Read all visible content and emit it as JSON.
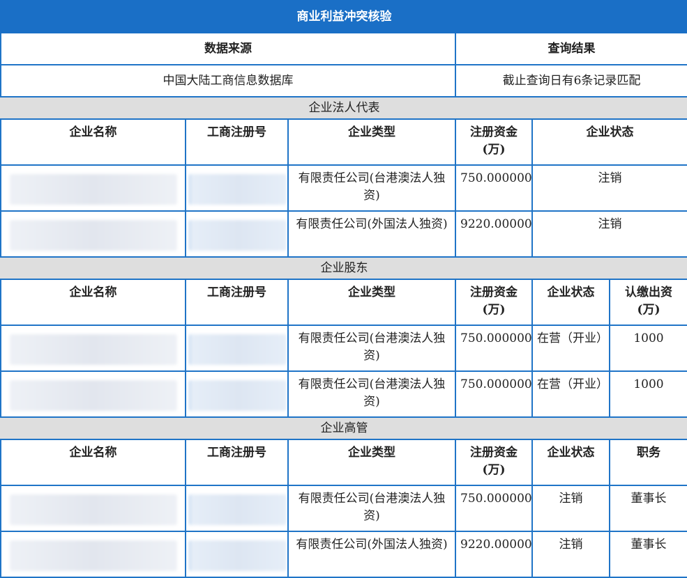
{
  "title": "商业利益冲突核验",
  "source": {
    "header_source": "数据来源",
    "header_result": "查询结果",
    "value_source": "中国大陆工商信息数据库",
    "value_result": "截止查询日有6条记录匹配"
  },
  "sections": {
    "legal": {
      "title": "企业法人代表",
      "headers": [
        "企业名称",
        "工商注册号",
        "企业类型",
        "注册资金(万)",
        "企业状态"
      ],
      "rows": [
        {
          "type": "有限责任公司(台港澳法人独资)",
          "capital": "750.000000",
          "status": "注销"
        },
        {
          "type": "有限责任公司(外国法人独资)",
          "capital": "9220.000000",
          "status": "注销"
        }
      ]
    },
    "shareholder": {
      "title": "企业股东",
      "headers": [
        "企业名称",
        "工商注册号",
        "企业类型",
        "注册资金(万)",
        "企业状态",
        "认缴出资(万)"
      ],
      "rows": [
        {
          "type": "有限责任公司(台港澳法人独资)",
          "capital": "750.000000",
          "status": "在营（开业）",
          "extra": "1000"
        },
        {
          "type": "有限责任公司(台港澳法人独资)",
          "capital": "750.000000",
          "status": "在营（开业）",
          "extra": "1000"
        }
      ]
    },
    "executive": {
      "title": "企业高管",
      "headers": [
        "企业名称",
        "工商注册号",
        "企业类型",
        "注册资金(万)",
        "企业状态",
        "职务"
      ],
      "rows": [
        {
          "type": "有限责任公司(台港澳法人独资)",
          "capital": "750.000000",
          "status": "注销",
          "extra": "董事长"
        },
        {
          "type": "有限责任公司(外国法人独资)",
          "capital": "9220.000000",
          "status": "注销",
          "extra": "董事长"
        }
      ]
    }
  }
}
